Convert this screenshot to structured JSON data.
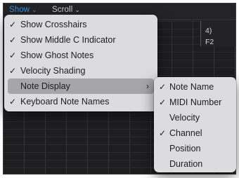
{
  "toolbar": {
    "show_label": "Show",
    "scroll_label": "Scroll",
    "chevron": "⌄"
  },
  "ruler": {
    "bar": "4)",
    "note": "F2"
  },
  "show_menu": {
    "items": [
      {
        "label": "Show Crosshairs",
        "checked": true,
        "check": "✓"
      },
      {
        "label": "Show Middle C Indicator",
        "checked": true,
        "check": "✓"
      },
      {
        "label": "Show Ghost Notes",
        "checked": true,
        "check": "✓"
      },
      {
        "label": "Velocity Shading",
        "checked": true,
        "check": "✓"
      },
      {
        "label": "Note Display",
        "checked": false,
        "submenu": true,
        "highlighted": true,
        "arrow": "›"
      },
      {
        "label": "Keyboard Note Names",
        "checked": true,
        "check": "✓"
      }
    ]
  },
  "note_display_menu": {
    "items": [
      {
        "label": "Note Name",
        "checked": true,
        "check": "✓"
      },
      {
        "label": "MIDI Number",
        "checked": true,
        "check": "✓"
      },
      {
        "label": "Velocity",
        "checked": false
      },
      {
        "label": "Channel",
        "checked": true,
        "check": "✓"
      },
      {
        "label": "Position",
        "checked": false
      },
      {
        "label": "Duration",
        "checked": false
      }
    ]
  },
  "colors": {
    "accent": "#3a8ee6",
    "menu_bg": "#dcdcde",
    "menu_highlight": "#a6a6a9",
    "editor_bg": "#1e1e20"
  }
}
